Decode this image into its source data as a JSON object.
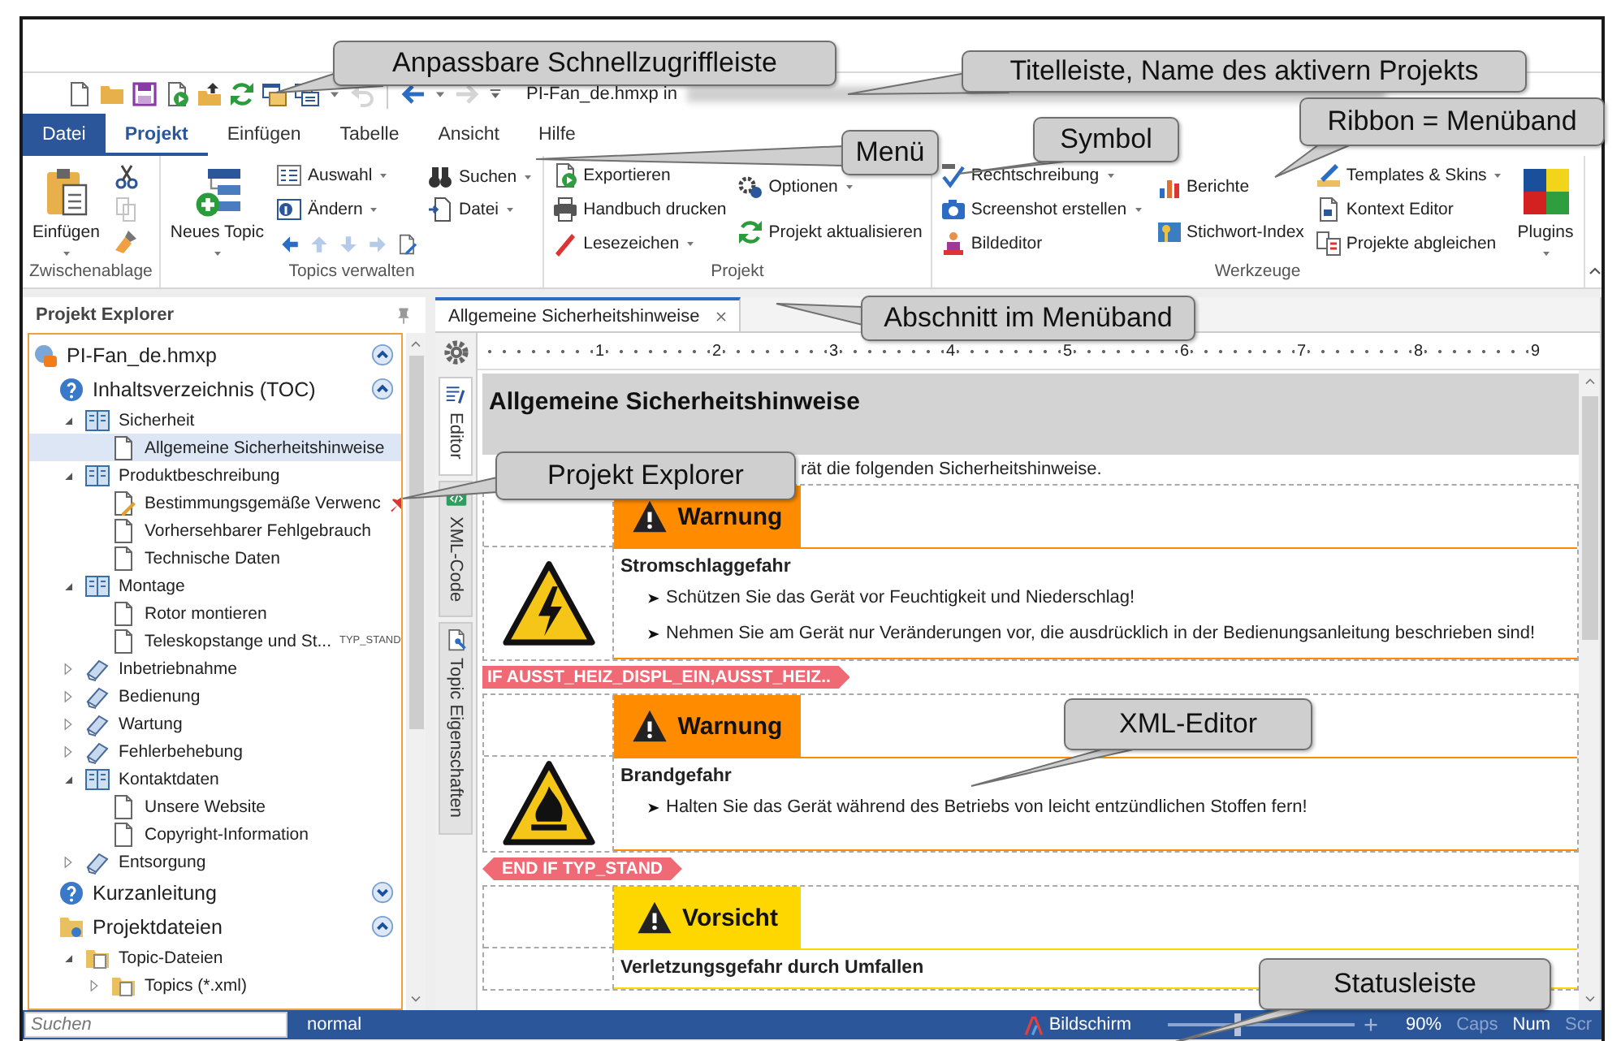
{
  "callouts": [
    {
      "text": "Anpassbare Schnellzugriffleiste"
    },
    {
      "text": "Titelleiste, Name des aktivern Projekts"
    },
    {
      "text": "Ribbon = Menüband"
    },
    {
      "text": "Menü"
    },
    {
      "text": "Symbol"
    },
    {
      "text": "Abschnitt im Menüband"
    },
    {
      "text": "Projekt Explorer"
    },
    {
      "text": "XML-Editor"
    },
    {
      "text": "Statusleiste"
    }
  ],
  "quick_access": [
    {
      "disabled": false
    },
    {
      "disabled": false
    },
    {
      "disabled": false
    },
    {
      "disabled": false
    },
    {
      "disabled": false
    },
    {
      "disabled": false
    },
    {
      "disabled": false
    },
    {
      "disabled": false
    },
    {
      "disabled": false
    },
    {
      "disabled": true
    },
    {
      "disabled": false
    },
    {
      "disabled": false
    },
    {
      "disabled": true
    },
    {
      "disabled": false
    }
  ],
  "title": {
    "text": "PI-Fan_de.hmxp in"
  },
  "menu": [
    {
      "label": "Datei",
      "kind": "file",
      "selected": false
    },
    {
      "label": "Projekt",
      "kind": "tab",
      "selected": true
    },
    {
      "label": "Einfügen",
      "kind": "tab",
      "selected": false
    },
    {
      "label": "Tabelle",
      "kind": "tab",
      "selected": false
    },
    {
      "label": "Ansicht",
      "kind": "tab",
      "selected": false
    },
    {
      "label": "Hilfe",
      "kind": "tab",
      "selected": false
    }
  ],
  "ribbon": {
    "groups": [
      {
        "label": "Zwischenablage",
        "columns": [
          [
            {
              "kind": "large",
              "label": "Einfügen",
              "dropdown": true
            }
          ],
          [
            {
              "kind": "icon",
              "disabled": false
            },
            {
              "kind": "icon",
              "disabled": true
            },
            {
              "kind": "icon",
              "disabled": false
            }
          ]
        ]
      },
      {
        "label": "Topics verwalten",
        "columns": [
          [
            {
              "kind": "large",
              "label": "Neues Topic",
              "dropdown": true
            }
          ],
          [
            {
              "kind": "small",
              "label": "Auswahl",
              "dropdown": true
            },
            {
              "kind": "small",
              "label": "Ändern",
              "dropdown": true
            },
            {
              "kind": "iconrow",
              "buttons": [
                {
                  "disabled": false
                },
                {
                  "disabled": true
                },
                {
                  "disabled": true
                },
                {
                  "disabled": true
                },
                {
                  "disabled": false
                }
              ]
            }
          ],
          [
            {
              "kind": "small",
              "label": "Suchen",
              "dropdown": true
            },
            {
              "kind": "small",
              "label": "Datei",
              "dropdown": true
            }
          ]
        ]
      },
      {
        "label": "Projekt",
        "columns": [
          [
            {
              "kind": "small",
              "label": "Exportieren",
              "dropdown": false
            },
            {
              "kind": "small",
              "label": "Handbuch drucken",
              "dropdown": false
            },
            {
              "kind": "small",
              "label": "Lesezeichen",
              "dropdown": true
            }
          ],
          [
            {
              "kind": "small",
              "label": "Optionen",
              "dropdown": true
            },
            {
              "kind": "small",
              "label": "Projekt aktualisieren",
              "dropdown": false
            }
          ]
        ]
      },
      {
        "label": "Werkzeuge",
        "columns": [
          [
            {
              "kind": "small",
              "label": "Rechtschreibung",
              "dropdown": true
            },
            {
              "kind": "small",
              "label": "Screenshot erstellen",
              "dropdown": true
            },
            {
              "kind": "small",
              "label": "Bildeditor",
              "dropdown": false
            }
          ],
          [
            {
              "kind": "small",
              "label": "Berichte",
              "dropdown": false
            },
            {
              "kind": "small",
              "label": "Stichwort-Index",
              "dropdown": false
            }
          ],
          [
            {
              "kind": "small",
              "label": "Templates & Skins",
              "dropdown": true
            },
            {
              "kind": "small",
              "label": "Kontext Editor",
              "dropdown": false
            },
            {
              "kind": "small",
              "label": "Projekte abgleichen",
              "dropdown": false
            }
          ],
          [
            {
              "kind": "large",
              "label": "Plugins",
              "dropdown": true
            }
          ]
        ]
      }
    ]
  },
  "explorer": {
    "title": "Projekt Explorer",
    "tree": {
      "label": "PI-Fan_de.hmxp",
      "kind": "project",
      "expanded": true,
      "selected": false,
      "children": [
        {
          "label": "Inhaltsverzeichnis (TOC)",
          "kind": "section",
          "expanded": true,
          "selected": false,
          "children": [
            {
              "label": "Sicherheit",
              "kind": "chapter",
              "expanded": true,
              "selected": false,
              "children": [
                {
                  "label": "Allgemeine Sicherheitshinweise",
                  "kind": "topic",
                  "selected": true,
                  "pinned": false
                }
              ]
            },
            {
              "label": "Produktbeschreibung",
              "kind": "chapter",
              "expanded": true,
              "selected": false,
              "children": [
                {
                  "label": "Bestimmungsgemäße Verwenc",
                  "kind": "topicedit",
                  "selected": false,
                  "pinned": true
                },
                {
                  "label": "Vorhersehbarer Fehlgebrauch",
                  "kind": "topic",
                  "selected": false,
                  "pinned": false
                },
                {
                  "label": "Technische Daten",
                  "kind": "topic",
                  "selected": false,
                  "pinned": false
                }
              ]
            },
            {
              "label": "Montage",
              "kind": "chapter",
              "expanded": true,
              "selected": false,
              "children": [
                {
                  "label": "Rotor montieren",
                  "kind": "topic",
                  "selected": false,
                  "pinned": false
                },
                {
                  "label": "Teleskopstange und St...",
                  "kind": "topic",
                  "selected": false,
                  "pinned": false,
                  "tag": "TYP_STAND"
                }
              ]
            },
            {
              "label": "Inbetriebnahme",
              "kind": "chapter",
              "expanded": false,
              "selected": false
            },
            {
              "label": "Bedienung",
              "kind": "chapter",
              "expanded": false,
              "selected": false
            },
            {
              "label": "Wartung",
              "kind": "chapter",
              "expanded": false,
              "selected": false
            },
            {
              "label": "Fehlerbehebung",
              "kind": "chapter",
              "expanded": false,
              "selected": false
            },
            {
              "label": "Kontaktdaten",
              "kind": "chapter",
              "expanded": true,
              "selected": false,
              "children": [
                {
                  "label": "Unsere Website",
                  "kind": "topic",
                  "selected": false,
                  "pinned": false
                },
                {
                  "label": "Copyright-Information",
                  "kind": "topic",
                  "selected": false,
                  "pinned": false
                }
              ]
            },
            {
              "label": "Entsorgung",
              "kind": "chapter",
              "expanded": false,
              "selected": false
            }
          ]
        },
        {
          "label": "Kurzanleitung",
          "kind": "section",
          "expanded": false,
          "selected": false
        },
        {
          "label": "Projektdateien",
          "kind": "files",
          "expanded": true,
          "selected": false,
          "children": [
            {
              "label": "Topic-Dateien",
              "kind": "folder",
              "expanded": true,
              "selected": false,
              "children": [
                {
                  "label": "Topics (*.xml)",
                  "kind": "folder",
                  "expanded": false,
                  "selected": false
                }
              ]
            }
          ]
        }
      ]
    }
  },
  "editor": {
    "tab": {
      "label": "Allgemeine Sicherheitshinweise"
    },
    "side_tabs": [
      {
        "label": "Editor",
        "selected": true
      },
      {
        "label": "XML-Code",
        "selected": false
      },
      {
        "label": "Topic Eigenschaften",
        "selected": false
      }
    ],
    "ruler": [
      "1",
      "2",
      "3",
      "4",
      "5",
      "6",
      "7",
      "8",
      "9"
    ],
    "heading": "Allgemeine Sicherheitshinweise",
    "intro": "rät die folgenden Sicherheitshinweise.",
    "blocks": [
      {
        "kind": "warning",
        "signal": "Warnung",
        "color": "#ff8c00",
        "title": "Stromschlaggefahr",
        "items": [
          "Schützen Sie das Gerät vor Feuchtigkeit und Niederschlag!",
          "Nehmen Sie am Gerät nur Veränderungen vor, die ausdrücklich in der Bedienungsanleitung beschrieben sind!"
        ]
      },
      {
        "kind": "if",
        "text": "IF AUSST_HEIZ_DISPL_EIN,AUSST_HEIZ.."
      },
      {
        "kind": "warning",
        "signal": "Warnung",
        "color": "#ff8c00",
        "title": "Brandgefahr",
        "items": [
          "Halten Sie das Gerät während des Betriebs von leicht entzündlichen Stoffen fern!"
        ]
      },
      {
        "kind": "endif",
        "text": "END IF TYP_STAND"
      },
      {
        "kind": "warning",
        "signal": "Vorsicht",
        "color": "#ffd700",
        "title": "Verletzungsgefahr durch Umfallen"
      }
    ]
  },
  "status": {
    "search": {
      "placeholder": "Suchen"
    },
    "mode": "normal",
    "view": "Bildschirm",
    "zoom": {
      "level": 0.38
    },
    "zoom_reading": "90%",
    "indicators": [
      {
        "label": "Caps",
        "on": false
      },
      {
        "label": "Num",
        "on": true
      },
      {
        "label": "Scr",
        "on": false
      }
    ]
  }
}
